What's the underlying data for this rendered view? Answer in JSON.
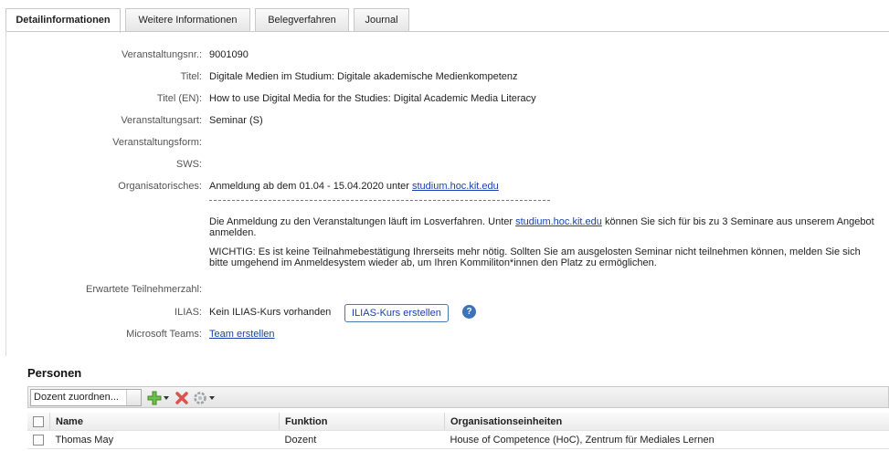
{
  "tabs": [
    {
      "label": "Detailinformationen",
      "active": true
    },
    {
      "label": "Weitere Informationen",
      "active": false
    },
    {
      "label": "Belegverfahren",
      "active": false
    },
    {
      "label": "Journal",
      "active": false
    }
  ],
  "details": {
    "nr_label": "Veranstaltungsnr.:",
    "nr_value": "9001090",
    "titel_label": "Titel:",
    "titel_value": "Digitale Medien im Studium: Digitale akademische Medienkompetenz",
    "titel_en_label": "Titel (EN):",
    "titel_en_value": "How to use Digital Media for the Studies: Digital Academic Media Literacy",
    "art_label": "Veranstaltungsart:",
    "art_value": "Seminar (S)",
    "form_label": "Veranstaltungsform:",
    "sws_label": "SWS:",
    "org_label": "Organisatorisches:",
    "org_line1_text": "Anmeldung ab dem 01.04 - 15.04.2020 unter",
    "org_line1_link": "studium.hoc.kit.edu",
    "org_para1_pre": "Die Anmeldung zu den Veranstaltungen läuft im Losverfahren. Unter",
    "org_para1_link": "studium.hoc.kit.edu",
    "org_para1_post": "können Sie sich für bis zu 3 Seminare aus unserem Angebot anmelden.",
    "org_para2": "WICHTIG: Es ist keine Teilnahmebestätigung Ihrerseits mehr nötig. Sollten Sie am ausgelosten Seminar nicht teilnehmen können, melden Sie sich bitte umgehend im Anmeldesystem wieder ab, um Ihren Kommiliton*innen den Platz zu ermöglichen.",
    "teilnehmer_label": "Erwartete Teilnehmerzahl:",
    "ilias_label": "ILIAS:",
    "ilias_value": "Kein ILIAS-Kurs vorhanden",
    "ilias_button": "ILIAS-Kurs erstellen",
    "help_glyph": "?",
    "teams_label": "Microsoft Teams:",
    "teams_link": "Team erstellen"
  },
  "personen": {
    "title": "Personen",
    "assign_placeholder": "Dozent zuordnen...",
    "icons": {
      "add": "add-icon",
      "delete": "delete-icon",
      "settings": "settings-icon"
    },
    "columns": [
      "Name",
      "Funktion",
      "Organisationseinheiten"
    ],
    "rows": [
      {
        "name": "Thomas May",
        "funktion": "Dozent",
        "org": "House of Competence (HoC), Zentrum für Mediales Lernen"
      }
    ]
  },
  "colors": {
    "link": "#1a3fb3",
    "accent": "#3d74b8"
  }
}
